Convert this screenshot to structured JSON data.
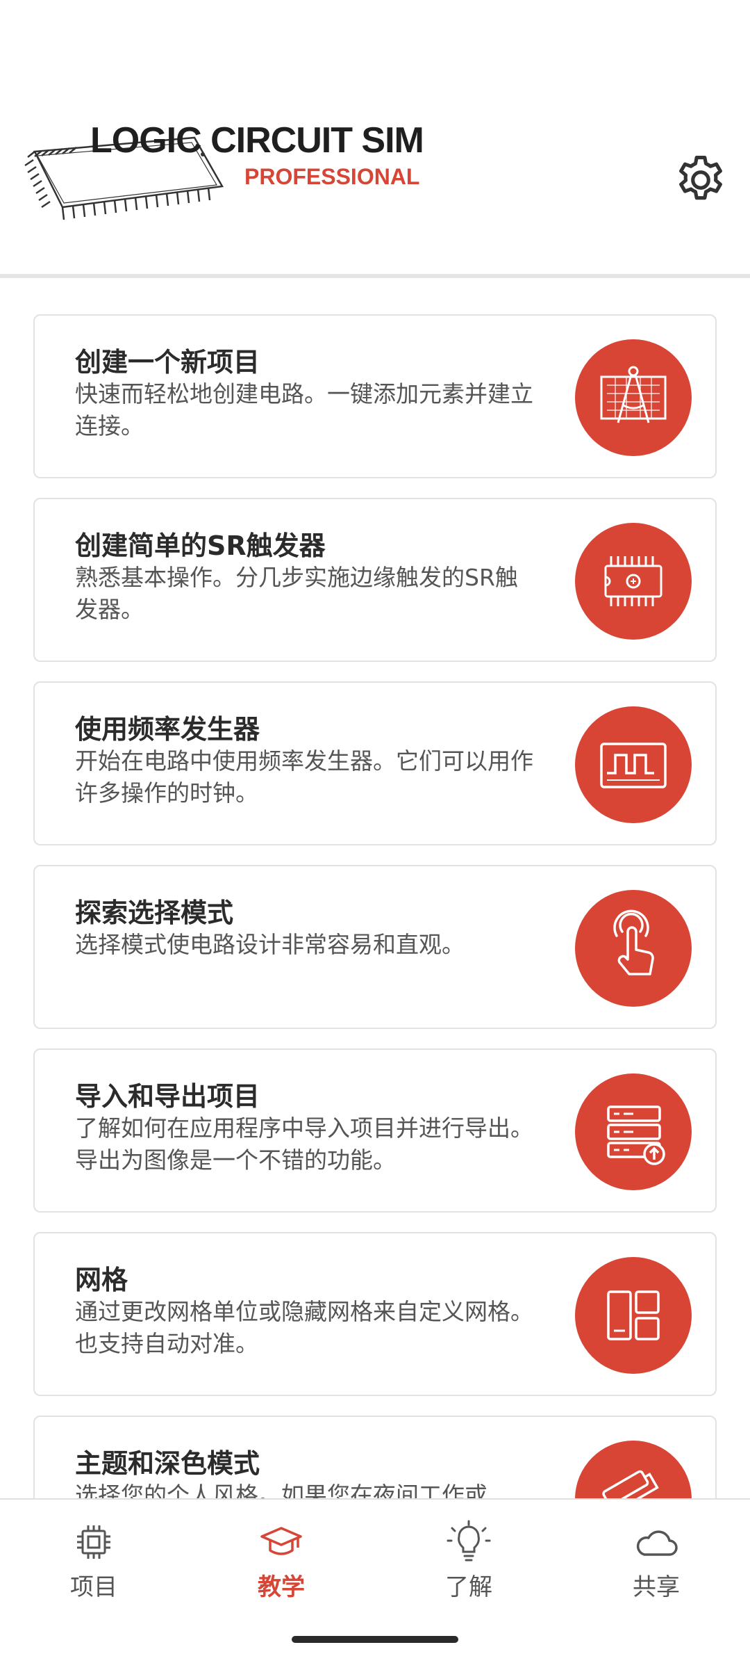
{
  "header": {
    "logo_title": "LOGIC CIRCUIT SIM",
    "logo_subtitle": "PROFESSIONAL",
    "settings_icon": "gear-icon"
  },
  "colors": {
    "accent": "#d84535",
    "text": "#2b2b2b",
    "muted": "#555555",
    "border": "#e2e2e2"
  },
  "tutorials": [
    {
      "title": "创建一个新项目",
      "description": "快速而轻松地创建电路。一键添加元素并建立连接。",
      "icon": "drafting-compass-icon"
    },
    {
      "title": "创建简单的SR触发器",
      "description": "熟悉基本操作。分几步实施边缘触发的SR触发器。",
      "icon": "ic-chip-icon"
    },
    {
      "title": "使用频率发生器",
      "description": "开始在电路中使用频率发生器。它们可以用作许多操作的时钟。",
      "icon": "square-wave-icon"
    },
    {
      "title": "探索选择模式",
      "description": "选择模式使电路设计非常容易和直观。",
      "icon": "tap-hand-icon"
    },
    {
      "title": "导入和导出项目",
      "description": "了解如何在应用程序中导入项目并进行导出。导出为图像是一个不错的功能。",
      "icon": "server-upload-icon"
    },
    {
      "title": "网格",
      "description": "通过更改网格单位或隐藏网格来自定义网格。也支持自动对准。",
      "icon": "grid-layout-icon"
    },
    {
      "title": "主题和深色模式",
      "description": "选择您的个人风格。如果您在夜间工作或",
      "icon": "paint-roller-icon"
    }
  ],
  "bottom_nav": [
    {
      "label": "项目",
      "icon": "chip-icon",
      "active": false
    },
    {
      "label": "教学",
      "icon": "graduation-cap-icon",
      "active": true
    },
    {
      "label": "了解",
      "icon": "lightbulb-icon",
      "active": false
    },
    {
      "label": "共享",
      "icon": "cloud-icon",
      "active": false
    }
  ]
}
